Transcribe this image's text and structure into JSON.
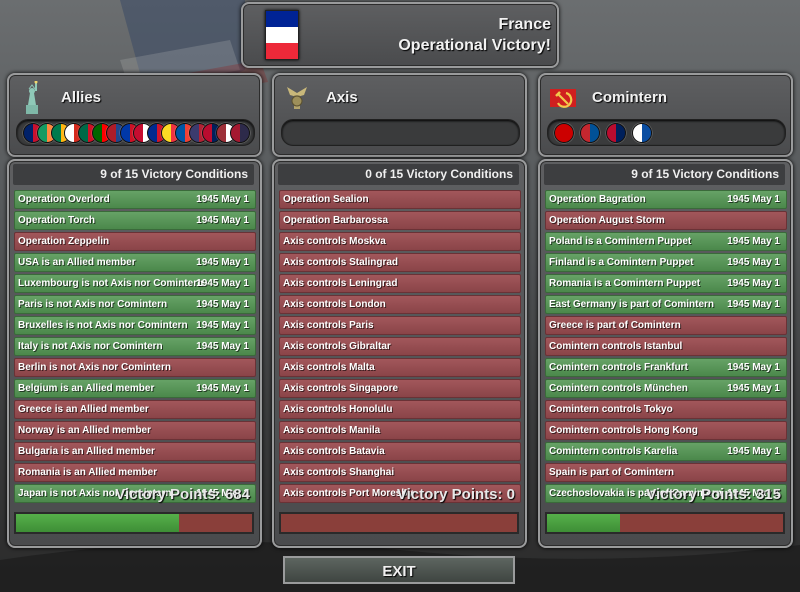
{
  "header": {
    "country": "France",
    "result": "Operational Victory!",
    "flag_colors": [
      "#002395",
      "#ffffff",
      "#ed2939"
    ]
  },
  "factions": [
    {
      "name": "Allies",
      "icon": "statue-of-liberty-icon",
      "member_flags": [
        "uk",
        "ireland",
        "south-africa",
        "canada",
        "mexico",
        "portugal",
        "netherlands",
        "philippines",
        "denmark",
        "cuba",
        "belgium",
        "france",
        "usa",
        "norway",
        "latvia",
        "thailand"
      ],
      "conditions_header": "9 of 15 Victory Conditions",
      "conditions": [
        {
          "label": "Operation Overlord",
          "met": true,
          "date": "1945 May 1"
        },
        {
          "label": "Operation Torch",
          "met": true,
          "date": "1945 May 1"
        },
        {
          "label": "Operation Zeppelin",
          "met": false,
          "date": ""
        },
        {
          "label": "USA is an Allied member",
          "met": true,
          "date": "1945 May 1"
        },
        {
          "label": "Luxembourg is not Axis nor Comintern",
          "met": true,
          "date": "1945 May 1"
        },
        {
          "label": "Paris is not Axis nor Comintern",
          "met": true,
          "date": "1945 May 1"
        },
        {
          "label": "Bruxelles is not Axis nor Comintern",
          "met": true,
          "date": "1945 May 1"
        },
        {
          "label": "Italy is not Axis nor Comintern",
          "met": true,
          "date": "1945 May 1"
        },
        {
          "label": "Berlin is not Axis nor Comintern",
          "met": false,
          "date": ""
        },
        {
          "label": "Belgium is an Allied member",
          "met": true,
          "date": "1945 May 1"
        },
        {
          "label": "Greece is an Allied member",
          "met": false,
          "date": ""
        },
        {
          "label": "Norway is an Allied member",
          "met": false,
          "date": ""
        },
        {
          "label": "Bulgaria is an Allied member",
          "met": false,
          "date": ""
        },
        {
          "label": "Romania is an Allied member",
          "met": false,
          "date": ""
        },
        {
          "label": "Japan is not Axis nor Comintern",
          "met": true,
          "date": "1945 May 1"
        }
      ],
      "victory_points_text": "Victory Points: 684",
      "progress": 0.69
    },
    {
      "name": "Axis",
      "icon": "eagle-insignia-icon",
      "member_flags": [],
      "conditions_header": "0 of 15 Victory Conditions",
      "conditions": [
        {
          "label": "Operation Sealion",
          "met": false,
          "date": ""
        },
        {
          "label": "Operation Barbarossa",
          "met": false,
          "date": ""
        },
        {
          "label": "Axis controls Moskva",
          "met": false,
          "date": ""
        },
        {
          "label": "Axis controls Stalingrad",
          "met": false,
          "date": ""
        },
        {
          "label": "Axis controls Leningrad",
          "met": false,
          "date": ""
        },
        {
          "label": "Axis controls London",
          "met": false,
          "date": ""
        },
        {
          "label": "Axis controls Paris",
          "met": false,
          "date": ""
        },
        {
          "label": "Axis controls Gibraltar",
          "met": false,
          "date": ""
        },
        {
          "label": "Axis controls Malta",
          "met": false,
          "date": ""
        },
        {
          "label": "Axis controls Singapore",
          "met": false,
          "date": ""
        },
        {
          "label": "Axis controls Honolulu",
          "met": false,
          "date": ""
        },
        {
          "label": "Axis controls Manila",
          "met": false,
          "date": ""
        },
        {
          "label": "Axis controls Batavia",
          "met": false,
          "date": ""
        },
        {
          "label": "Axis controls Shanghai",
          "met": false,
          "date": ""
        },
        {
          "label": "Axis controls Port Moresby",
          "met": false,
          "date": ""
        }
      ],
      "victory_points_text": "Victory Points: 0",
      "progress": 0.0
    },
    {
      "name": "Comintern",
      "icon": "hammer-sickle-icon",
      "member_flags": [
        "ussr",
        "mongolia",
        "norway",
        "slovakia"
      ],
      "conditions_header": "9 of 15 Victory Conditions",
      "conditions": [
        {
          "label": "Operation Bagration",
          "met": true,
          "date": "1945 May 1"
        },
        {
          "label": "Operation August Storm",
          "met": false,
          "date": ""
        },
        {
          "label": "Poland is a Comintern Puppet",
          "met": true,
          "date": "1945 May 1"
        },
        {
          "label": "Finland is a Comintern Puppet",
          "met": true,
          "date": "1945 May 1"
        },
        {
          "label": "Romania is a Comintern Puppet",
          "met": true,
          "date": "1945 May 1"
        },
        {
          "label": "East Germany is part of Comintern",
          "met": true,
          "date": "1945 May 1"
        },
        {
          "label": "Greece is part of Comintern",
          "met": false,
          "date": ""
        },
        {
          "label": "Comintern controls Istanbul",
          "met": false,
          "date": ""
        },
        {
          "label": "Comintern controls Frankfurt",
          "met": true,
          "date": "1945 May 1"
        },
        {
          "label": "Comintern controls München",
          "met": true,
          "date": "1945 May 1"
        },
        {
          "label": "Comintern controls Tokyo",
          "met": false,
          "date": ""
        },
        {
          "label": "Comintern controls Hong Kong",
          "met": false,
          "date": ""
        },
        {
          "label": "Comintern controls Karelia",
          "met": true,
          "date": "1945 May 1"
        },
        {
          "label": "Spain is part of Comintern",
          "met": false,
          "date": ""
        },
        {
          "label": "Czechoslovakia is part of Comintern",
          "met": true,
          "date": "1945 May 1"
        }
      ],
      "victory_points_text": "Victory Points: 315",
      "progress": 0.31
    }
  ],
  "colors": {
    "met": "#55935a",
    "unmet": "#94494d",
    "bar_fill": "#4ea343",
    "bar_empty": "#8a3f3a"
  },
  "exit_label": "EXIT"
}
